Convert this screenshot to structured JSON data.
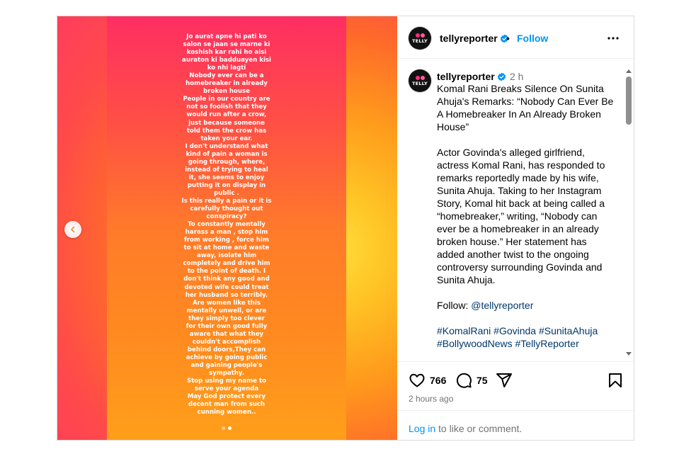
{
  "story": {
    "text": "Jo aurat apne hi pati ko\nsalon se jaan se marne ki\nkoshish kar rahi ho aisi\nauraton ki badduayen kisi\nko nhi lagti\nNobody ever can be a\nhomebreaker in already\nbroken house\nPeople in our country are\nnot so foolish that they\nwould run after a crow,\njust because someone\ntold them the crow has\ntaken your ear.\nI don't understand what\nkind of pain a woman is\ngoing through, where,\ninstead of trying to heal\nit, she seems to enjoy\nputting it on display in\npublic .\nIs this really a pain or it is\ncarefully thought out\nconspiracy?\nTo constantly mentally\nharass a man , stop him\nfrom working , force him\nto sit at home and waste\naway, isolate him\ncompletely and drive him\nto the point of death. I\ndon't think any good and\ndevoted wife could treat\nher husband so terribly.\nAre women like this\nmentally unwell, or are\nthey simply too clever\nfor their own good fully\naware that what they\ncouldn't accomplish\nbehind doors,They can\nachieve by going public\nand gaining people's\nsympathy.\nStop using my name to\nserve your agenda\nMay God protect every\ndecent man from such\ncunning women..",
    "slide_count": 2,
    "active_slide": 2
  },
  "header": {
    "username": "tellyreporter",
    "separator": "•",
    "follow_label": "Follow",
    "avatar_text": "TELLY"
  },
  "caption": {
    "username": "tellyreporter",
    "time": "2 h",
    "headline": "Komal Rani Breaks Silence On Sunita Ahuja's Remarks: “Nobody Can Ever Be A Homebreaker In An Already Broken House”",
    "body": "Actor Govinda's alleged girlfriend, actress Komal Rani, has responded to remarks reportedly made by his wife, Sunita Ahuja. Taking to her Instagram Story, Komal hit back at being called a “homebreaker,” writing, “Nobody can ever be a homebreaker in an already broken house.” Her statement has added another twist to the ongoing controversy surrounding Govinda and Sunita Ahuja.",
    "follow_prefix": "Follow: ",
    "follow_handle": "@tellyreporter",
    "hashtags_line1": "#KomalRani #Govinda #SunitaAhuja",
    "hashtags_line2": "#BollywoodNews #TellyReporter"
  },
  "actions": {
    "likes": "766",
    "comments": "75",
    "posted_ago": "2 hours ago"
  },
  "login": {
    "link_label": "Log in",
    "rest": " to like or comment."
  },
  "colors": {
    "link_blue": "#0095f6",
    "verified_blue": "#0095f6",
    "muted": "#737373"
  }
}
